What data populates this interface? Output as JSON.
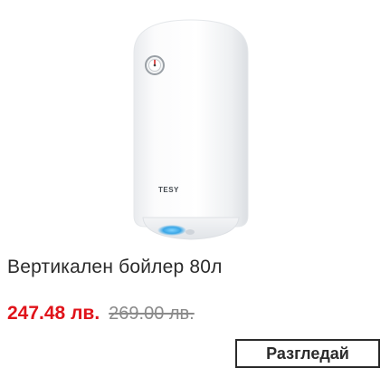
{
  "product": {
    "title": "Вертикален бойлер 80л",
    "brand_mark": "TESY",
    "price_current": "247.48 лв.",
    "price_old": "269.00 лв.",
    "view_button_label": "Разгледай"
  },
  "colors": {
    "price_current": "#e0131a",
    "price_old": "#8a8a8a",
    "text": "#2b2b2b",
    "button_border": "#2b2b2b"
  }
}
